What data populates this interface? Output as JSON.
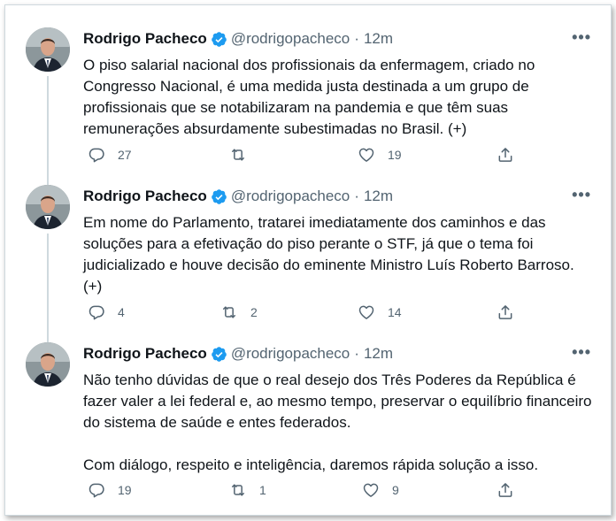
{
  "tweets": [
    {
      "author": "Rodrigo Pacheco",
      "handle": "@rodrigopacheco",
      "separator": "·",
      "time": "12m",
      "more": "•••",
      "text": "O piso salarial nacional dos profissionais da enfermagem, criado no Congresso Nacional, é uma medida justa destinada a um grupo de profissionais que se notabilizaram na pandemia e que têm suas remunerações absurdamente subestimadas no Brasil. (+)",
      "replies": "27",
      "retweets": "",
      "likes": "19"
    },
    {
      "author": "Rodrigo Pacheco",
      "handle": "@rodrigopacheco",
      "separator": "·",
      "time": "12m",
      "more": "•••",
      "text": "Em nome do Parlamento, tratarei imediatamente dos caminhos e das soluções para a efetivação do piso perante o STF, já que o tema foi judicializado e houve decisão do eminente Ministro Luís Roberto Barroso. (+)",
      "replies": "4",
      "retweets": "2",
      "likes": "14"
    },
    {
      "author": "Rodrigo Pacheco",
      "handle": "@rodrigopacheco",
      "separator": "·",
      "time": "12m",
      "more": "•••",
      "text": "Não tenho dúvidas de que o real desejo dos Três Poderes da República é fazer valer a lei federal e, ao mesmo tempo, preservar o equilíbrio financeiro do sistema de saúde e entes federados.\n\nCom diálogo, respeito e inteligência, daremos rápida solução a isso.",
      "replies": "19",
      "retweets": "1",
      "likes": "9"
    }
  ],
  "colors": {
    "text": "#0f1419",
    "secondary": "#536471",
    "verified": "#1d9bf0",
    "thread_line": "#cfd9de"
  },
  "icons": [
    "verified-badge-icon",
    "reply-icon",
    "retweet-icon",
    "like-icon",
    "share-icon",
    "more-icon"
  ]
}
